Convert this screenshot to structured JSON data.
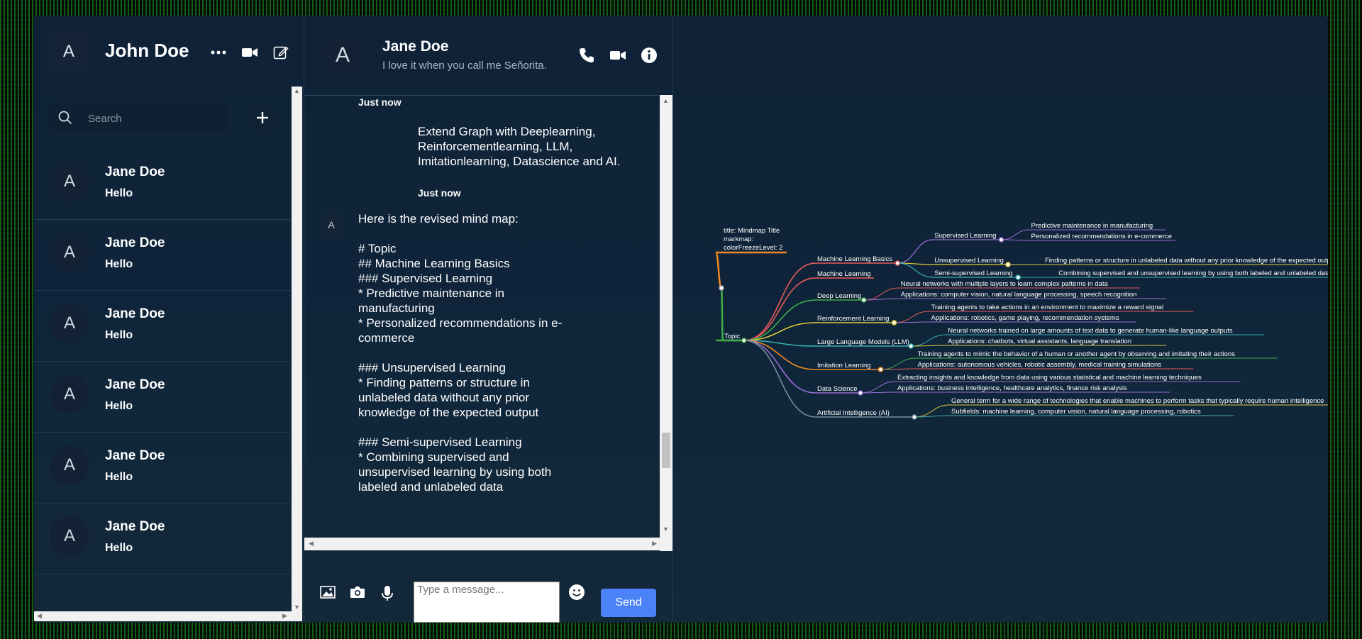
{
  "user": {
    "avatar_letter": "A",
    "name": "John Doe"
  },
  "sidebar": {
    "icons": [
      "more-icon",
      "video-icon",
      "compose-icon"
    ],
    "search": {
      "placeholder": "Search"
    },
    "contacts": [
      {
        "avatar_letter": "A",
        "name": "Jane Doe",
        "last_message": "Hello"
      },
      {
        "avatar_letter": "A",
        "name": "Jane Doe",
        "last_message": "Hello"
      },
      {
        "avatar_letter": "A",
        "name": "Jane Doe",
        "last_message": "Hello"
      },
      {
        "avatar_letter": "A",
        "name": "Jane Doe",
        "last_message": "Hello"
      },
      {
        "avatar_letter": "A",
        "name": "Jane Doe",
        "last_message": "Hello"
      },
      {
        "avatar_letter": "A",
        "name": "Jane Doe",
        "last_message": "Hello"
      }
    ]
  },
  "chat": {
    "header": {
      "avatar_letter": "A",
      "name": "Jane Doe",
      "status": "I love it when you call me Señorita."
    },
    "messages": {
      "time_top": "Just now",
      "sent_text": "Extend Graph with Deeplearning, Reinforcementlearning, LLM, Imitationlearning, Datascience and AI.",
      "sent_time": "Just now",
      "recv_avatar_letter": "A",
      "recv_text": "Here is the revised mind map:\n\n# Topic\n## Machine Learning Basics\n### Supervised Learning\n* Predictive maintenance in manufacturing\n* Personalized recommendations in e-commerce\n\n### Unsupervised Learning\n* Finding patterns or structure in unlabeled data without any prior knowledge of the expected output\n\n### Semi-supervised Learning\n* Combining supervised and unsupervised learning by using both labeled and unlabeled data"
    },
    "composer": {
      "placeholder": "Type a message...",
      "send_label": "Send"
    }
  },
  "mindmap": {
    "header_lines": [
      "title: Mindmap Title",
      "markmap:",
      "colorFreezeLevel: 2"
    ],
    "root": "Topic",
    "branches": [
      {
        "label": "Machine Learning Basics",
        "color": "#e85a5a",
        "children": [
          {
            "label": "Supervised Learning",
            "color": "#9a6fd6",
            "children": [
              {
                "label": "Predictive maintenance in manufacturing",
                "color": "#9a6fd6"
              },
              {
                "label": "Personalized recommendations in e-commerce",
                "color": "#9a6fd6"
              }
            ]
          },
          {
            "label": "Unsupervised Learning",
            "color": "#e0c83a",
            "children": [
              {
                "label": "Finding patterns or structure in unlabeled data without any prior knowledge of the expected output",
                "color": "#e0c83a"
              }
            ]
          },
          {
            "label": "Semi-supervised Learning",
            "color": "#3ab0b0",
            "children": [
              {
                "label": "Combining supervised and unsupervised learning by using both labeled and unlabeled data",
                "color": "#3ab0b0"
              }
            ]
          }
        ]
      },
      {
        "label": "Machine Learning",
        "color": "#e85a5a",
        "children": []
      },
      {
        "label": "Deep Learning",
        "color": "#3fae49",
        "children": [
          {
            "label": "Neural networks with multiple layers to learn complex patterns in data",
            "color": "#e85a5a"
          },
          {
            "label": "Applications: computer vision, natural language processing, speech recognition",
            "color": "#9a6fd6"
          }
        ]
      },
      {
        "label": "Reinforcement Learning",
        "color": "#e0c83a",
        "children": [
          {
            "label": "Training agents to take actions in an environment to maximize a reward signal",
            "color": "#e85a5a"
          },
          {
            "label": "Applications: robotics, game playing, recommendation systems",
            "color": "#9a6fd6"
          }
        ]
      },
      {
        "label": "Large Language Models (LLM)",
        "color": "#3ab0b0",
        "children": [
          {
            "label": "Neural networks trained on large amounts of text data to generate human-like language outputs",
            "color": "#3ab0b0"
          },
          {
            "label": "Applications: chatbots, virtual assistants, language translation",
            "color": "#e0c83a"
          }
        ]
      },
      {
        "label": "Imitation Learning",
        "color": "#f08a24",
        "children": [
          {
            "label": "Training agents to mimic the behavior of a human or another agent by observing and imitating their actions",
            "color": "#3fae49"
          },
          {
            "label": "Applications: autonomous vehicles, robotic assembly, medical training simulations",
            "color": "#e85a5a"
          }
        ]
      },
      {
        "label": "Data Science",
        "color": "#9a6fd6",
        "children": [
          {
            "label": "Extracting insights and knowledge from data using various statistical and machine learning techniques",
            "color": "#9a6fd6"
          },
          {
            "label": "Applications: business intelligence, healthcare analytics, finance risk analysis",
            "color": "#9a6fd6"
          }
        ]
      },
      {
        "label": "Artificial Intelligence (AI)",
        "color": "#7a8aa0",
        "children": [
          {
            "label": "General term for a wide range of technologies that enable machines to perform tasks that typically require human intelligence",
            "color": "#e0c83a"
          },
          {
            "label": "Subfields: machine learning, computer vision, natural language processing, robotics",
            "color": "#3ab0b0"
          }
        ]
      }
    ],
    "colors": {
      "header_link": "#f08a24",
      "root_link": "#3fae49"
    }
  }
}
